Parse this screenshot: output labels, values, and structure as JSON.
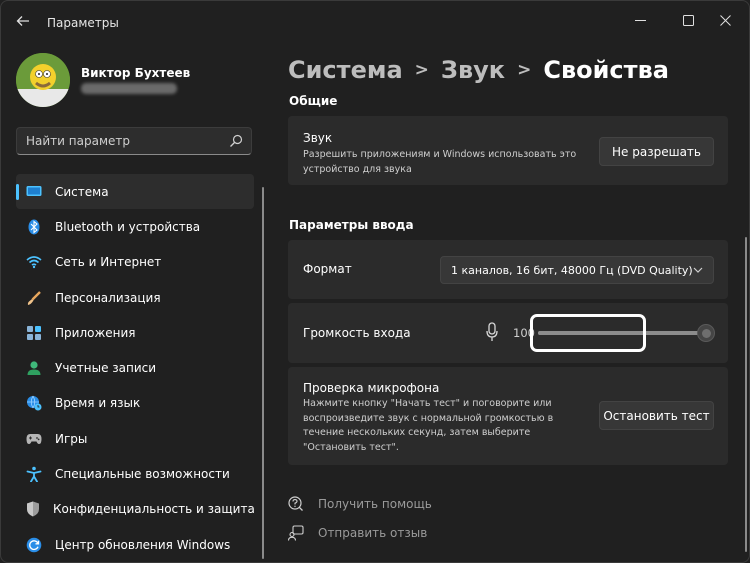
{
  "window": {
    "title": "Параметры"
  },
  "profile": {
    "name": "Виктор Бухтеев"
  },
  "search": {
    "placeholder": "Найти параметр"
  },
  "sidebar": {
    "items": [
      {
        "label": "Система",
        "icon": "monitor-icon",
        "active": true
      },
      {
        "label": "Bluetooth и устройства",
        "icon": "bluetooth-icon"
      },
      {
        "label": "Сеть и Интернет",
        "icon": "wifi-icon"
      },
      {
        "label": "Персонализация",
        "icon": "brush-icon"
      },
      {
        "label": "Приложения",
        "icon": "apps-icon"
      },
      {
        "label": "Учетные записи",
        "icon": "person-icon"
      },
      {
        "label": "Время и язык",
        "icon": "globe-clock-icon"
      },
      {
        "label": "Игры",
        "icon": "gamepad-icon"
      },
      {
        "label": "Специальные возможности",
        "icon": "accessibility-icon"
      },
      {
        "label": "Конфиденциальность и защита",
        "icon": "shield-icon"
      },
      {
        "label": "Центр обновления Windows",
        "icon": "update-icon"
      }
    ]
  },
  "breadcrumb": {
    "items": [
      "Система",
      "Звук"
    ],
    "current": "Свойства"
  },
  "general": {
    "title": "Общие",
    "sound": {
      "title": "Звук",
      "desc_line1": "Разрешить приложениям и Windows использовать это",
      "desc_line2": "устройство для звука",
      "button": "Не разрешать"
    }
  },
  "input": {
    "title": "Параметры ввода",
    "format": {
      "label": "Формат",
      "value": "1 каналов, 16 бит, 48000 Гц (DVD Quality)"
    },
    "volume": {
      "label": "Громкость входа",
      "value": "100",
      "level": 1.0
    },
    "mic_test": {
      "title": "Проверка микрофона",
      "desc_line1": "Нажмите кнопку \"Начать тест\" и поговорите или",
      "desc_line2": "воспроизведите звук с нормальной громкостью в",
      "desc_line3": "течение нескольких секунд, затем выберите",
      "desc_line4": "\"Остановить тест\".",
      "button": "Остановить тест"
    }
  },
  "links": {
    "help": "Получить помощь",
    "feedback": "Отправить отзыв"
  },
  "colors": {
    "accent": "#4cc2ff",
    "background": "#202020",
    "card": "#2b2b2b"
  }
}
